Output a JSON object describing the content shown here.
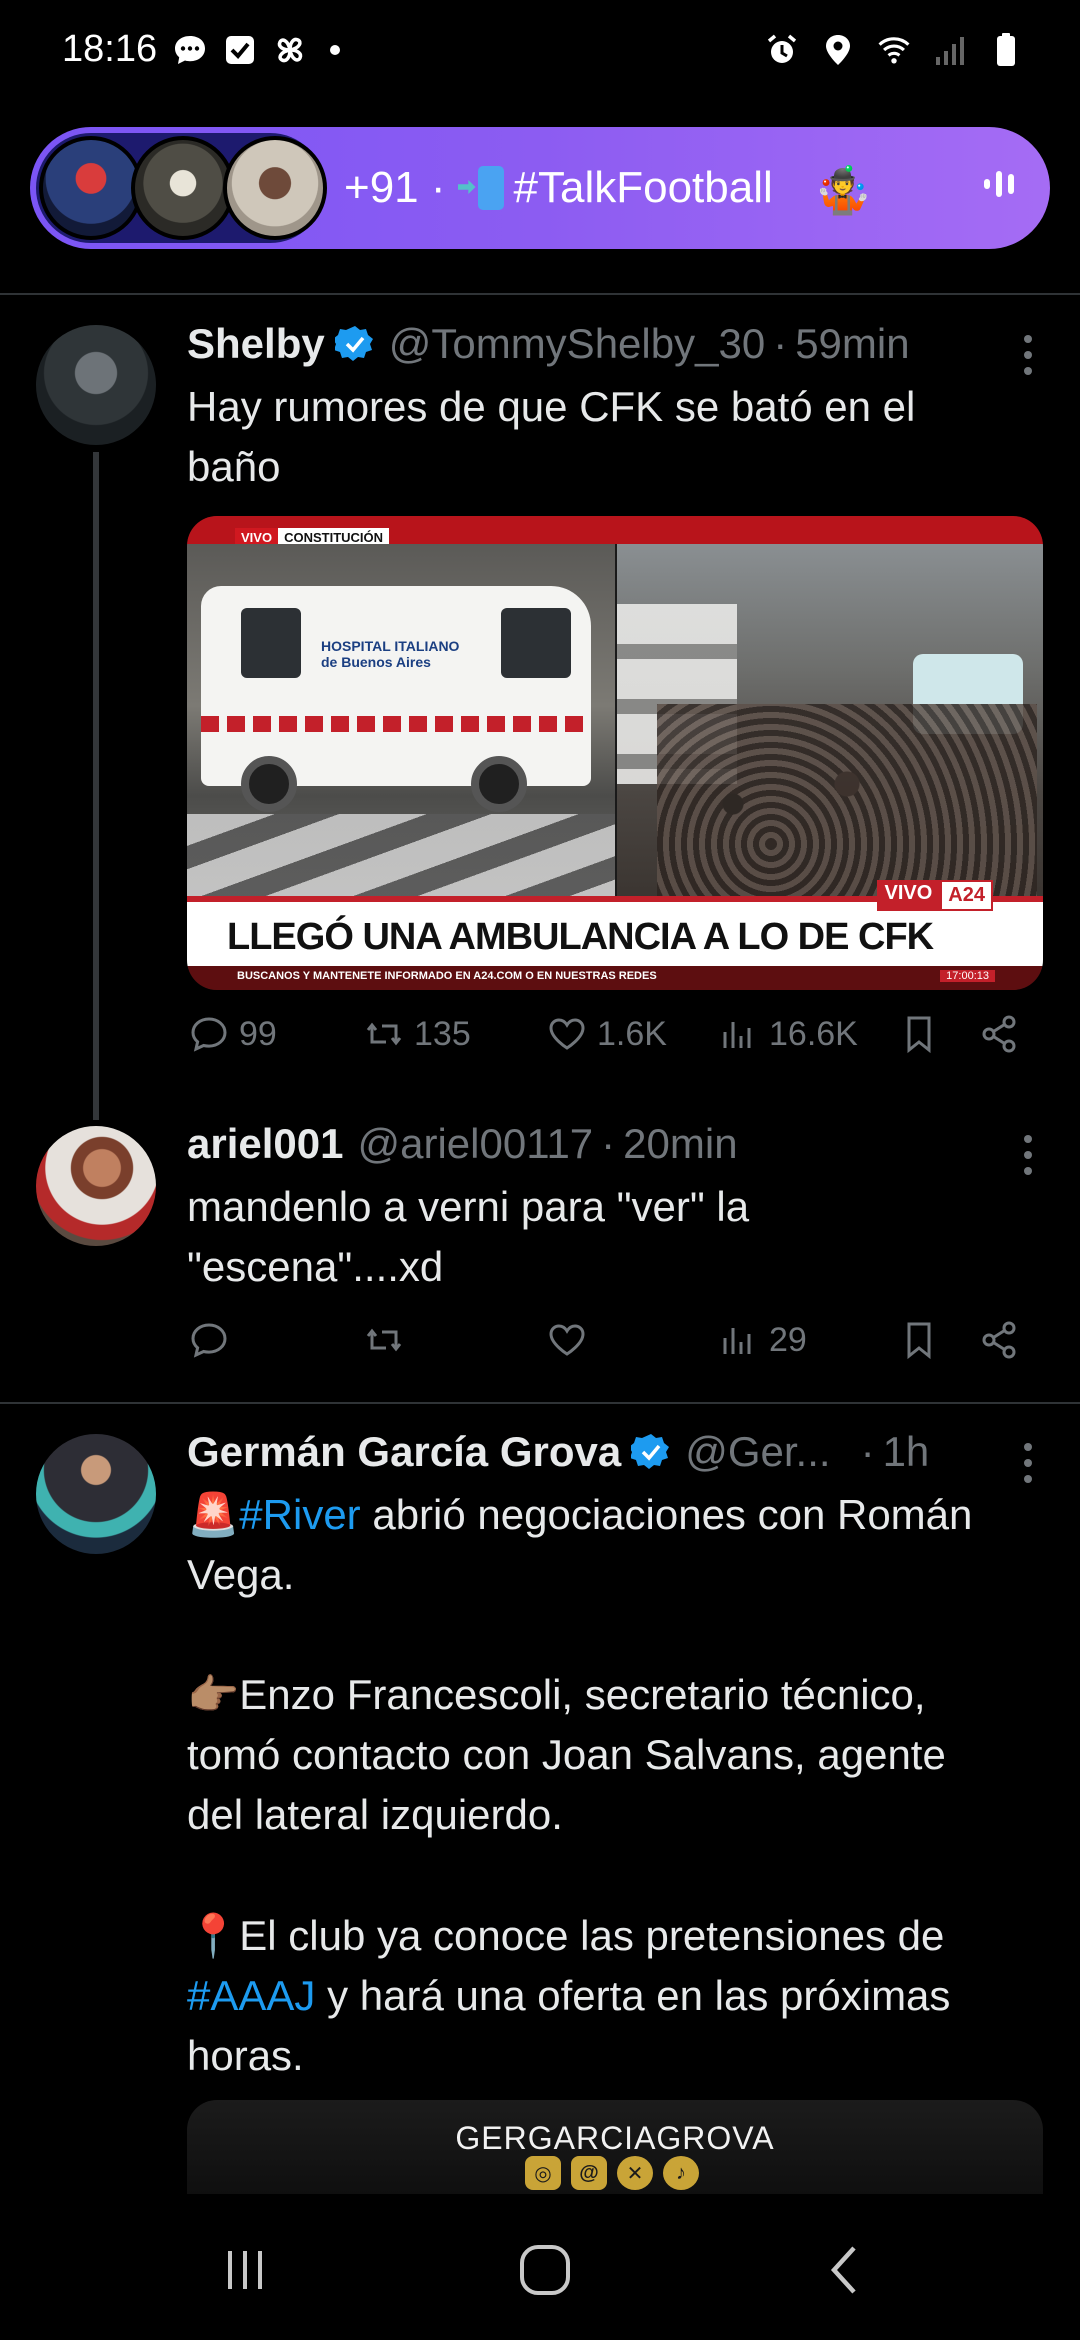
{
  "status_bar": {
    "time": "18:16",
    "left_icons": [
      "chat-bubble-icon",
      "checkbox-icon",
      "fan-icon",
      "dot-icon"
    ],
    "right_icons": [
      "alarm-icon",
      "location-icon",
      "wifi-icon",
      "signal-icon",
      "battery-icon"
    ]
  },
  "space_pill": {
    "listener_count": "+91 ·",
    "title": "#TalkFootball",
    "emoji": "🤹"
  },
  "tweets": [
    {
      "name": "Shelby",
      "verified": true,
      "handle": "@TommyShelby_30",
      "separator": "·",
      "time": "59min",
      "text": "Hay rumores de que CFK se bató en el\nbaño",
      "media": {
        "live_tag": "VIVO",
        "location_tag": "CONSTITUCIÓN",
        "ambulance_logo": "HOSPITAL ITALIANO de Buenos Aires",
        "banner": "LLEGÓ UNA AMBULANCIA A LO DE CFK",
        "channel_live": "VIVO",
        "channel_name": "A24",
        "ticker": "BUSCANOS Y MANTENETE INFORMADO EN A24.COM O EN NUESTRAS REDES",
        "clock": "17:00:13"
      },
      "actions": {
        "replies": "99",
        "reposts": "135",
        "likes": "1.6K",
        "views": "16.6K"
      }
    },
    {
      "name": "ariel001",
      "verified": false,
      "handle": "@ariel00117",
      "separator": "·",
      "time": "20min",
      "text": "mandenlo a verni para \"ver\" la\n\"escena\"....xd",
      "actions": {
        "replies": "",
        "reposts": "",
        "likes": "",
        "views": "29"
      }
    },
    {
      "name": "Germán García Grova",
      "verified": true,
      "handle": "@Ger...",
      "separator": "·",
      "time": "1h",
      "text_line1_emoji": "🚨",
      "text_line1_hashtag": "#River",
      "text_line1_rest": " abrió negociaciones con Román\nVega.",
      "text_para2": "👉🏽Enzo Francescoli, secretario técnico,\ntomó contacto con Joan Salvans, agente\ndel lateral izquierdo.",
      "text_para3_start": "📍El club ya conoce las pretensiones de\n",
      "text_para3_hashtag": "#AAAJ",
      "text_para3_end": " y hará una oferta en las próximas\nhoras.",
      "media_brand": "GERGARCIAGROVA"
    }
  ],
  "nav_bar": {
    "buttons": [
      "recent-apps",
      "home",
      "back"
    ]
  }
}
